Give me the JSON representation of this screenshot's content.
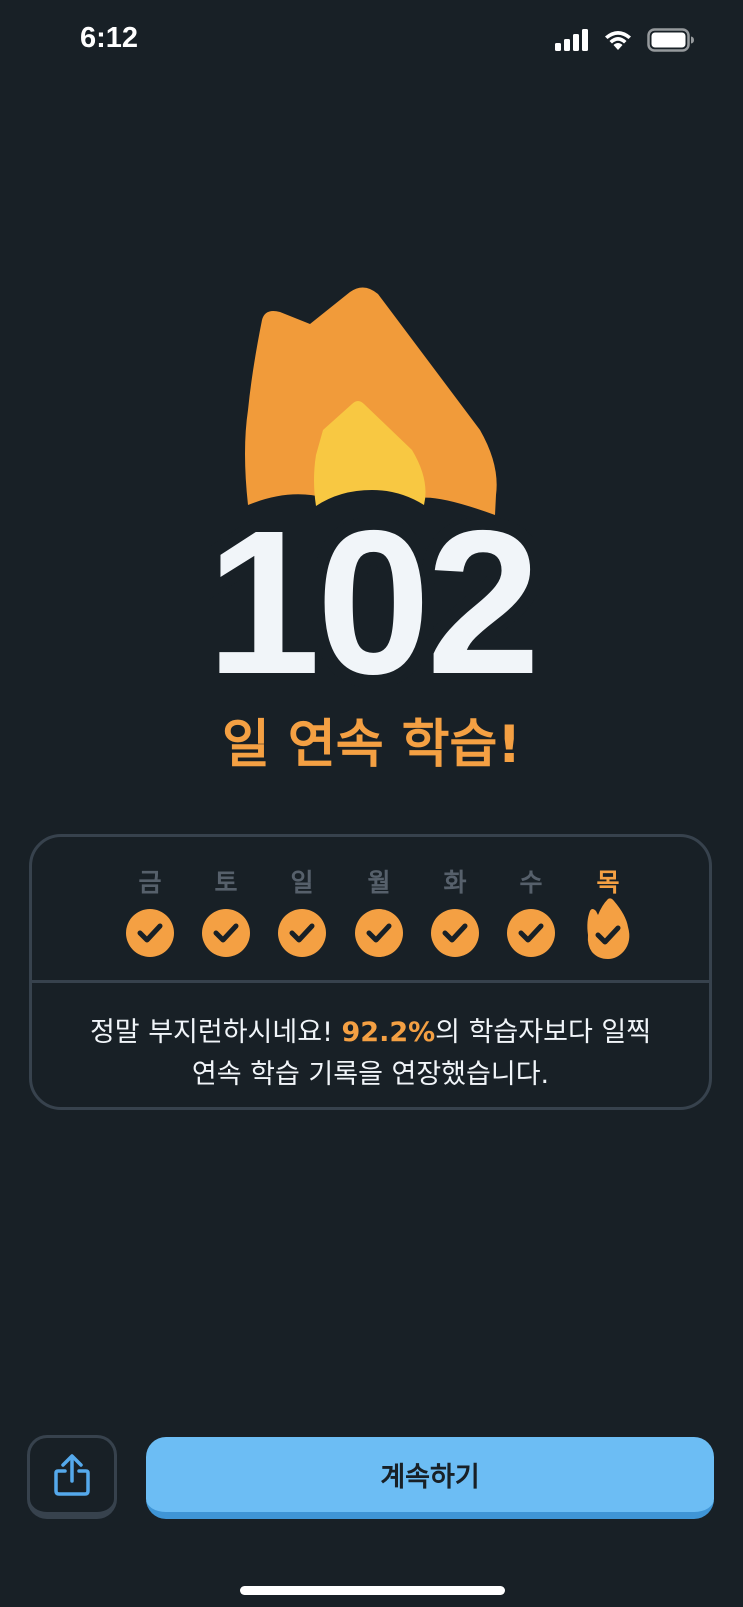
{
  "status_bar": {
    "time": "6:12"
  },
  "streak": {
    "number": "102",
    "label": "일 연속 학습!"
  },
  "week": {
    "days": [
      {
        "label": "금",
        "completed": true,
        "today": false
      },
      {
        "label": "토",
        "completed": true,
        "today": false
      },
      {
        "label": "일",
        "completed": true,
        "today": false
      },
      {
        "label": "월",
        "completed": true,
        "today": false
      },
      {
        "label": "화",
        "completed": true,
        "today": false
      },
      {
        "label": "수",
        "completed": true,
        "today": false
      },
      {
        "label": "목",
        "completed": true,
        "today": true
      }
    ]
  },
  "message": {
    "before": "정말 부지런하시네요! ",
    "percent": "92.2%",
    "after_line1": "의 학습자보다 일찍",
    "line2": "연속 학습 기록을 연장했습니다."
  },
  "actions": {
    "share_icon": "share-icon",
    "continue_label": "계속하기"
  },
  "colors": {
    "background": "#182026",
    "accent_orange": "#f4a043",
    "flame_inner": "#f8c842",
    "button_blue": "#6cbdf4",
    "border": "#37424d"
  }
}
